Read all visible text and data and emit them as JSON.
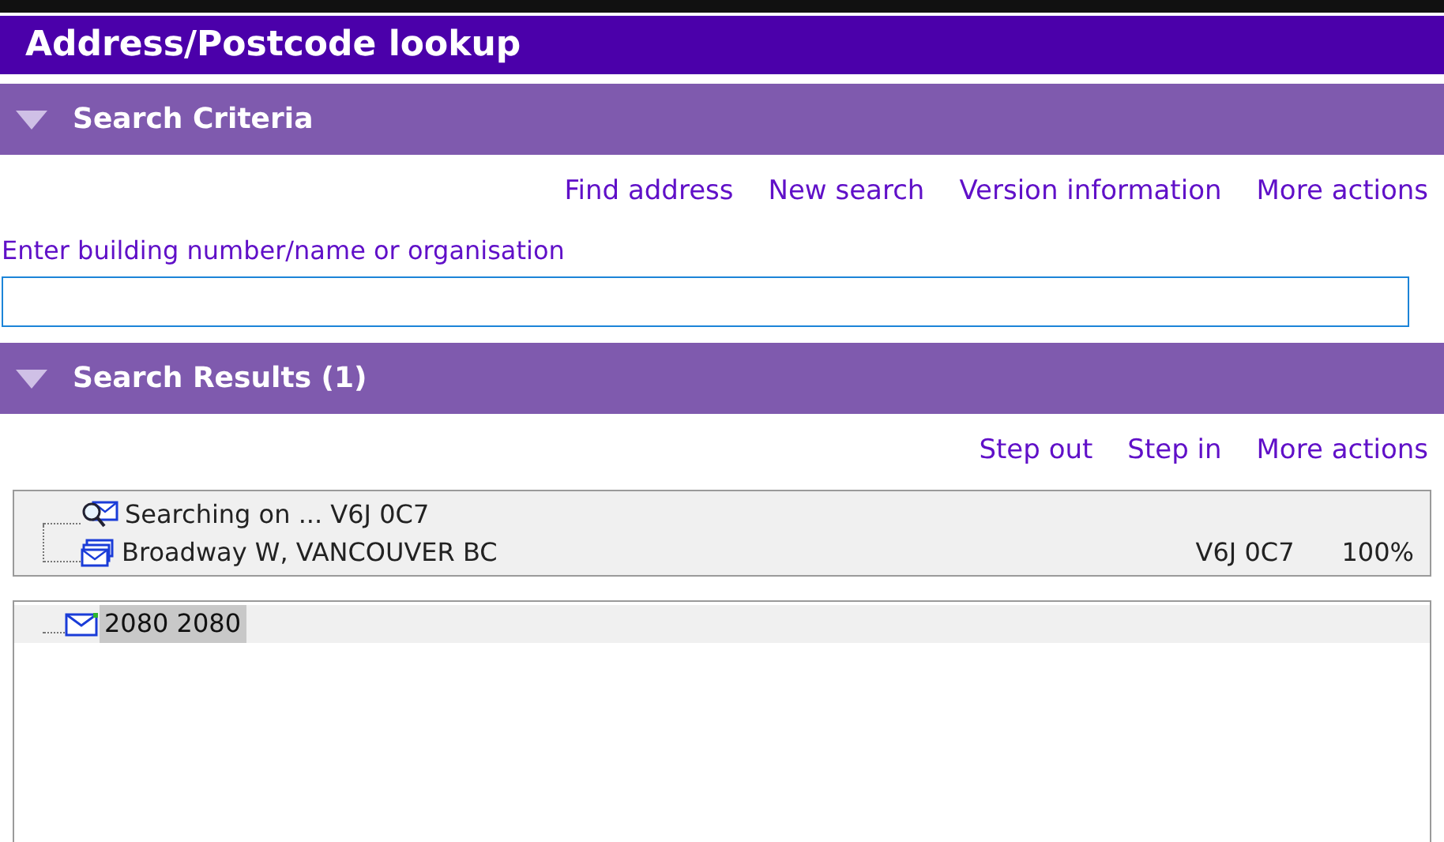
{
  "window": {
    "title": "Address/Postcode lookup"
  },
  "criteria": {
    "header": {
      "title": "Search Criteria",
      "expanded": true
    },
    "actions": [
      "Find address",
      "New search",
      "Version information",
      "More actions"
    ],
    "field": {
      "label": "Enter building number/name or organisation"
    }
  },
  "results": {
    "header": {
      "title": "Search Results (1)",
      "expanded": true
    },
    "actions": [
      "Step out",
      "Step in",
      "More actions"
    ],
    "path": [
      {
        "kind": "search",
        "text": "Searching on ... V6J 0C7"
      },
      {
        "kind": "stack",
        "text": "Broadway W, VANCOUVER BC",
        "postcode": "V6J 0C7",
        "match": "100%"
      }
    ],
    "items": [
      {
        "text": "2080 2080",
        "selected": true
      }
    ]
  }
}
